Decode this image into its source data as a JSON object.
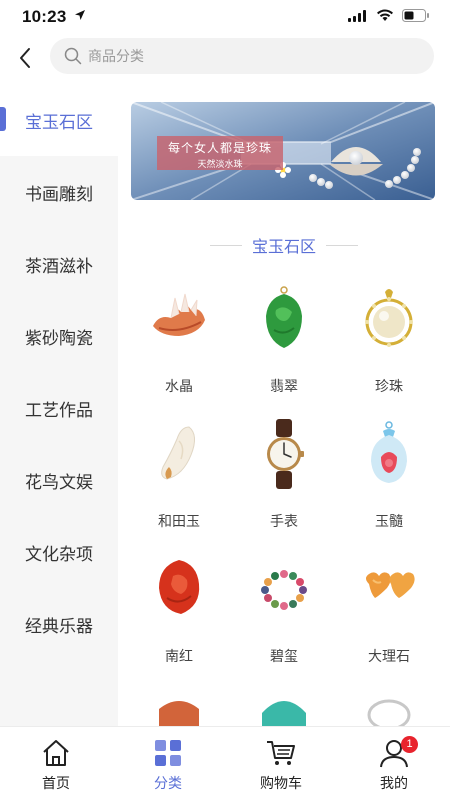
{
  "status_bar": {
    "time": "10:23"
  },
  "search": {
    "placeholder": "商品分类"
  },
  "sidebar": {
    "items": [
      {
        "label": "宝玉石区",
        "active": true
      },
      {
        "label": "书画雕刻"
      },
      {
        "label": "茶酒滋补"
      },
      {
        "label": "紫砂陶瓷"
      },
      {
        "label": "工艺作品"
      },
      {
        "label": "花鸟文娱"
      },
      {
        "label": "文化杂项"
      },
      {
        "label": "经典乐器"
      }
    ]
  },
  "banner": {
    "title": "每个女人都是珍珠",
    "subtitle": "天然淡水珠"
  },
  "section": {
    "title": "宝玉石区"
  },
  "categories": [
    {
      "label": "水晶",
      "icon": "crystal-icon"
    },
    {
      "label": "翡翠",
      "icon": "jade-icon"
    },
    {
      "label": "珍珠",
      "icon": "pearl-icon"
    },
    {
      "label": "和田玉",
      "icon": "hetian-jade-icon"
    },
    {
      "label": "手表",
      "icon": "watch-icon"
    },
    {
      "label": "玉髓",
      "icon": "chalcedony-icon"
    },
    {
      "label": "南红",
      "icon": "south-red-agate-icon"
    },
    {
      "label": "碧玺",
      "icon": "tourmaline-icon"
    },
    {
      "label": "大理石",
      "icon": "marble-icon"
    }
  ],
  "tabbar": {
    "items": [
      {
        "label": "首页",
        "icon": "home-icon"
      },
      {
        "label": "分类",
        "icon": "category-icon",
        "active": true
      },
      {
        "label": "购物车",
        "icon": "cart-icon"
      },
      {
        "label": "我的",
        "icon": "profile-icon",
        "badge": "1"
      }
    ]
  },
  "colors": {
    "accent": "#5a6fd6",
    "badge": "#e8232d",
    "sidebar_bg": "#f6f6f6"
  }
}
